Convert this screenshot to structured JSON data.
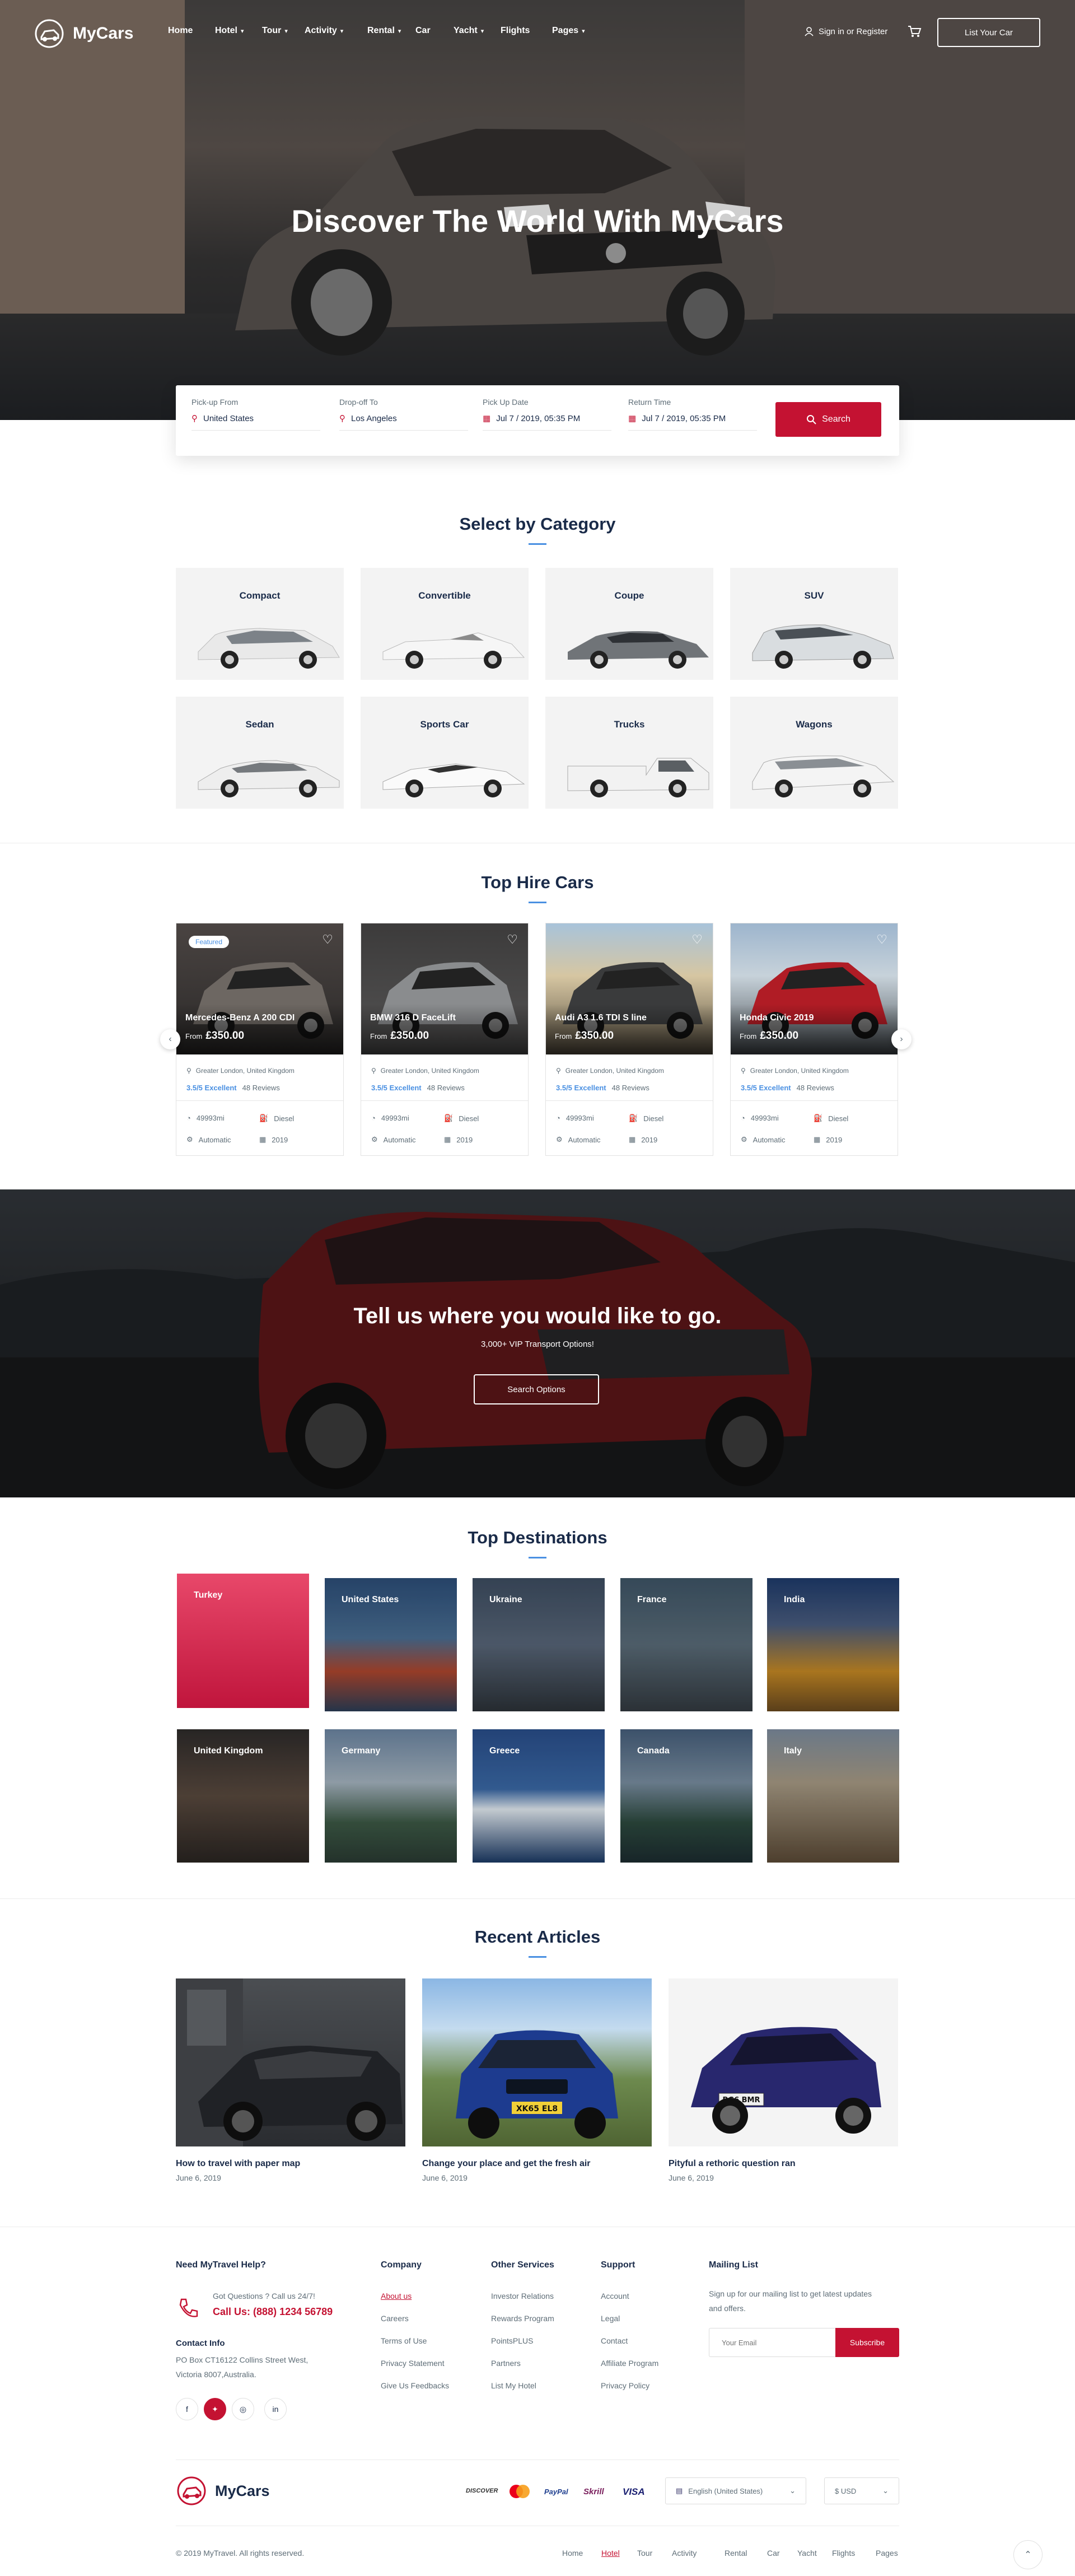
{
  "brand": {
    "name": "MyCars",
    "accent": "#c41232",
    "link": "#4a90e2",
    "text": "#1a2b49"
  },
  "nav": {
    "items": [
      {
        "label": "Home",
        "dropdown": false
      },
      {
        "label": "Hotel",
        "dropdown": true
      },
      {
        "label": "Tour",
        "dropdown": true
      },
      {
        "label": "Activity",
        "dropdown": true
      },
      {
        "label": "Rental",
        "dropdown": true
      },
      {
        "label": "Car",
        "dropdown": false
      },
      {
        "label": "Yacht",
        "dropdown": true
      },
      {
        "label": "Flights",
        "dropdown": false
      },
      {
        "label": "Pages",
        "dropdown": true
      }
    ],
    "signin": "Sign in or Register",
    "list_car": "List Your Car"
  },
  "hero": {
    "title": "Discover The World With MyCars"
  },
  "search": {
    "pickup_label": "Pick-up From",
    "pickup_value": "United States",
    "dropoff_label": "Drop-off To",
    "dropoff_value": "Los Angeles",
    "pickup_date_label": "Pick Up Date",
    "pickup_date_value": "Jul 7 / 2019, 05:35 PM",
    "return_label": "Return Time",
    "return_value": "Jul 7 / 2019, 05:35 PM",
    "button": "Search"
  },
  "categories": {
    "title": "Select by Category",
    "items": [
      "Compact",
      "Convertible",
      "Coupe",
      "SUV",
      "Sedan",
      "Sports Car",
      "Trucks",
      "Wagons"
    ]
  },
  "top_hire": {
    "title": "Top Hire Cars",
    "featured_label": "Featured",
    "cars": [
      {
        "name": "Mercedes-Benz A 200 CDI",
        "from": "From",
        "price": "£350.00",
        "location": "Greater London, United Kingdom",
        "rating": "3.5/5 Excellent",
        "reviews": "48 Reviews",
        "mileage": "49993mi",
        "fuel": "Diesel",
        "transmission": "Automatic",
        "year": "2019"
      },
      {
        "name": "BMW 316 D FaceLift",
        "from": "From",
        "price": "£350.00",
        "location": "Greater London, United Kingdom",
        "rating": "3.5/5 Excellent",
        "reviews": "48 Reviews",
        "mileage": "49993mi",
        "fuel": "Diesel",
        "transmission": "Automatic",
        "year": "2019"
      },
      {
        "name": "Audi A3 1.6 TDI S line",
        "from": "From",
        "price": "£350.00",
        "location": "Greater London, United Kingdom",
        "rating": "3.5/5 Excellent",
        "reviews": "48 Reviews",
        "mileage": "49993mi",
        "fuel": "Diesel",
        "transmission": "Automatic",
        "year": "2019"
      },
      {
        "name": "Honda Civic 2019",
        "from": "From",
        "price": "£350.00",
        "location": "Greater London, United Kingdom",
        "rating": "3.5/5 Excellent",
        "reviews": "48 Reviews",
        "mileage": "49993mi",
        "fuel": "Diesel",
        "transmission": "Automatic",
        "year": "2019"
      }
    ]
  },
  "banner": {
    "title": "Tell us where you would like to go.",
    "subtitle": "3,000+ VIP Transport Options!",
    "button": "Search Options"
  },
  "destinations": {
    "title": "Top Destinations",
    "items": [
      "Turkey",
      "United States",
      "Ukraine",
      "France",
      "India",
      "United Kingdom",
      "Germany",
      "Greece",
      "Canada",
      "Italy"
    ]
  },
  "articles": {
    "title": "Recent Articles",
    "items": [
      {
        "title": "How to travel with paper map",
        "date": "June 6, 2019"
      },
      {
        "title": "Change your place and get the fresh air",
        "date": "June 6, 2019"
      },
      {
        "title": "Pityful a rethoric question ran",
        "date": "June 6, 2019",
        "plate": "BG6 BMR"
      }
    ],
    "plate_2": "XK65 EL8"
  },
  "footer": {
    "help_title": "Need MyTravel Help?",
    "questions": "Got Questions ? Call us 24/7!",
    "call_label": "Call Us:",
    "phone": "(888) 1234 56789",
    "contact_title": "Contact Info",
    "address_1": "PO Box CT16122 Collins Street West,",
    "address_2": "Victoria 8007,Australia.",
    "company_title": "Company",
    "company_links": [
      "About us",
      "Careers",
      "Terms of Use",
      "Privacy Statement",
      "Give Us Feedbacks"
    ],
    "services_title": "Other Services",
    "services_links": [
      "Investor Relations",
      "Rewards Program",
      "PointsPLUS",
      "Partners",
      "List My Hotel"
    ],
    "support_title": "Support",
    "support_links": [
      "Account",
      "Legal",
      "Contact",
      "Affiliate Program",
      "Privacy Policy"
    ],
    "mailing_title": "Mailing List",
    "mailing_text_1": "Sign up for our mailing list to get latest updates",
    "mailing_text_2": "and offers.",
    "email_placeholder": "Your Email",
    "subscribe": "Subscribe",
    "payments": [
      "DISCOVER",
      "PayPal",
      "Skrill",
      "VISA"
    ],
    "language": "English (United States)",
    "currency": "$ USD",
    "copyright": "© 2019 MyTravel. All rights reserved.",
    "bottom_nav": [
      "Home",
      "Hotel",
      "Tour",
      "Activity",
      "Rental",
      "Car",
      "Yacht",
      "Flights",
      "Pages"
    ]
  }
}
